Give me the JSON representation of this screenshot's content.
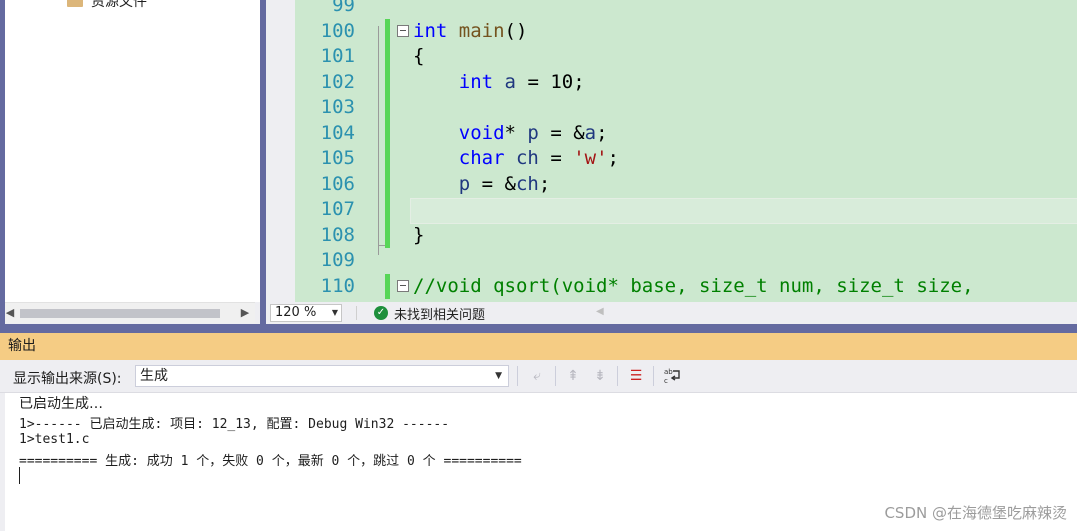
{
  "solution_explorer": {
    "items": [
      {
        "label": "资源文件",
        "icon": "folder-icon"
      }
    ]
  },
  "editor": {
    "lines": [
      {
        "n": "99",
        "html": ""
      },
      {
        "n": "100",
        "html": "<span class=\"kw\">int</span> <span class=\"func\">main</span>()"
      },
      {
        "n": "101",
        "html": "{"
      },
      {
        "n": "102",
        "html": "    <span class=\"kw\">int</span> <span class=\"var\">a</span> = 10;"
      },
      {
        "n": "103",
        "html": ""
      },
      {
        "n": "104",
        "html": "    <span class=\"kw\">void</span>* <span class=\"var\">p</span> = &amp;<span class=\"var\">a</span>;"
      },
      {
        "n": "105",
        "html": "    <span class=\"kw\">char</span> <span class=\"var\">ch</span> = <span class=\"str\">'w'</span>;"
      },
      {
        "n": "106",
        "html": "    <span class=\"var\">p</span> = &amp;<span class=\"var\">ch</span>;"
      },
      {
        "n": "107",
        "html": ""
      },
      {
        "n": "108",
        "html": "}"
      },
      {
        "n": "109",
        "html": ""
      },
      {
        "n": "110",
        "html": "<span class=\"cmt\">//void qsort(void* base, size_t num, size_t size,</span>"
      }
    ]
  },
  "status": {
    "zoom": "120 %",
    "issues": "未找到相关问题"
  },
  "output": {
    "title": "输出",
    "source_label": "显示输出来源(S):",
    "source_value": "生成",
    "lines": [
      "已启动生成…",
      "1>------ 已启动生成: 项目: 12_13, 配置: Debug Win32 ------",
      "1>test1.c",
      "========== 生成: 成功 1 个，失败 0 个，最新 0 个，跳过 0 个 =========="
    ]
  },
  "watermark": "CSDN @在海德堡吃麻辣烫"
}
